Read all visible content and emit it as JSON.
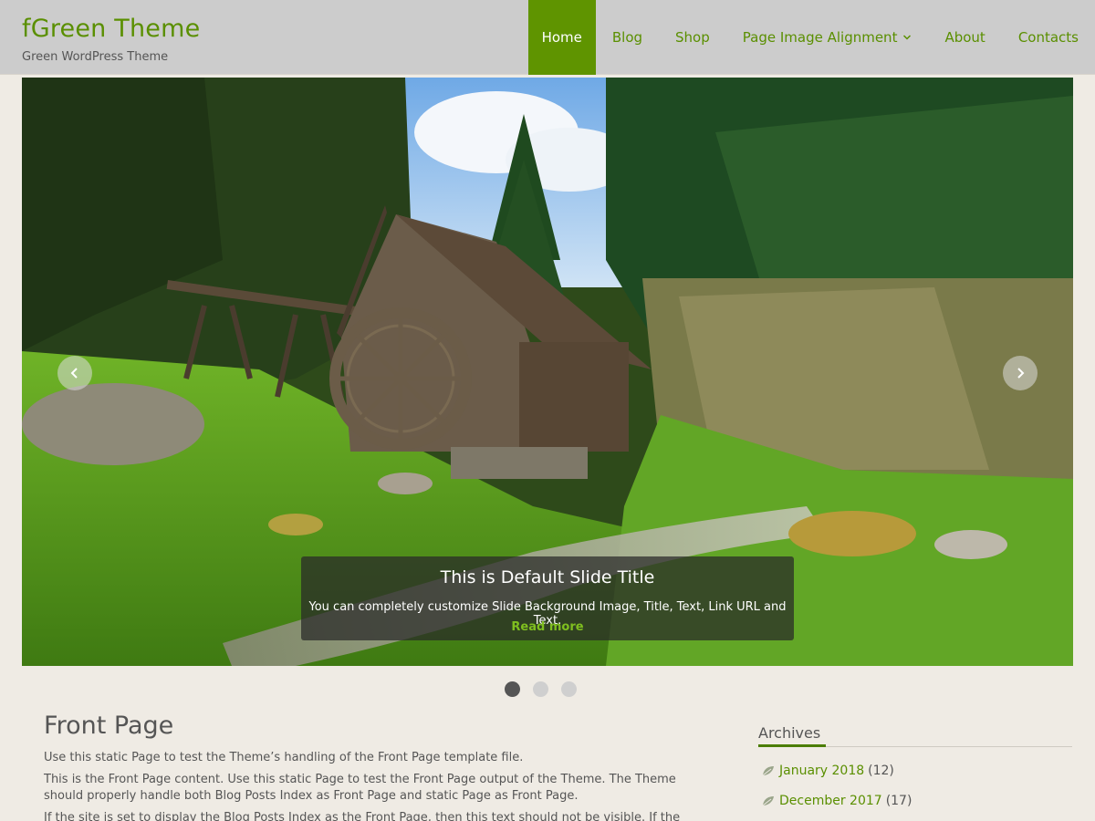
{
  "header": {
    "site_title": "fGreen Theme",
    "site_description": "Green WordPress Theme"
  },
  "nav": {
    "items": [
      {
        "label": "Home",
        "active": true
      },
      {
        "label": "Blog"
      },
      {
        "label": "Shop"
      },
      {
        "label": "Page Image Alignment",
        "has_dropdown": true
      },
      {
        "label": "About"
      },
      {
        "label": "Contacts"
      }
    ]
  },
  "slider": {
    "slide_title": "This is Default Slide Title",
    "slide_text": "You can completely customize Slide Background Image, Title, Text, Link URL and Text.",
    "slide_link": "Read more",
    "prev_icon": "chevron-left-icon",
    "next_icon": "chevron-right-icon",
    "dot_count": 3,
    "active_dot": 1
  },
  "content": {
    "title": "Front Page",
    "paragraphs": [
      "Use this static Page to test the Theme’s handling of the Front Page template file.",
      "This is the Front Page content. Use this static Page to test the Front Page output of the Theme. The Theme should properly handle both Blog Posts Index as Front Page and static Page as Front Page.",
      "If the site is set to display the Blog Posts Index as the Front Page, then this text should not be visible. If the site is set to"
    ]
  },
  "sidebar": {
    "archives_title": "Archives",
    "archives": [
      {
        "label": "January 2018",
        "count": "(12)"
      },
      {
        "label": "December 2017",
        "count": "(17)"
      }
    ]
  },
  "colors": {
    "accent": "#5f9400",
    "header_bg": "#cccccc",
    "page_bg": "#efebe4"
  }
}
